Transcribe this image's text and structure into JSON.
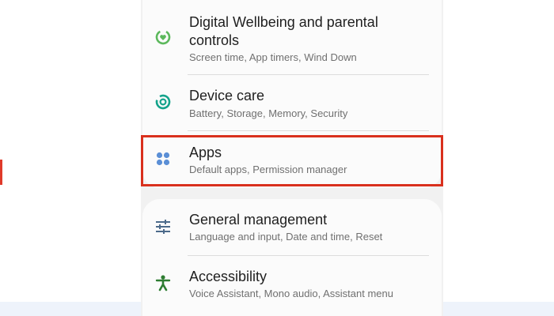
{
  "settings": {
    "items": [
      {
        "title": "Digital Wellbeing and parental controls",
        "title_line1": "Digital Wellbeing and parental",
        "title_line2": "controls",
        "subtitle": "Screen time, App timers, Wind Down",
        "icon": "digital-wellbeing-icon",
        "icon_color": "#5cb85c"
      },
      {
        "title": "Device care",
        "subtitle": "Battery, Storage, Memory, Security",
        "icon": "device-care-icon",
        "icon_color": "#14a38b"
      },
      {
        "title": "Apps",
        "subtitle": "Default apps, Permission manager",
        "icon": "apps-icon",
        "icon_color": "#5b8fd6"
      },
      {
        "title": "General management",
        "subtitle": "Language and input, Date and time, Reset",
        "icon": "general-management-icon",
        "icon_color": "#4c6a8a"
      },
      {
        "title": "Accessibility",
        "subtitle": "Voice Assistant, Mono audio, Assistant menu",
        "icon": "accessibility-icon",
        "icon_color": "#2e7d32"
      }
    ]
  },
  "highlight": {
    "target": "Apps",
    "color": "#d9301d"
  }
}
